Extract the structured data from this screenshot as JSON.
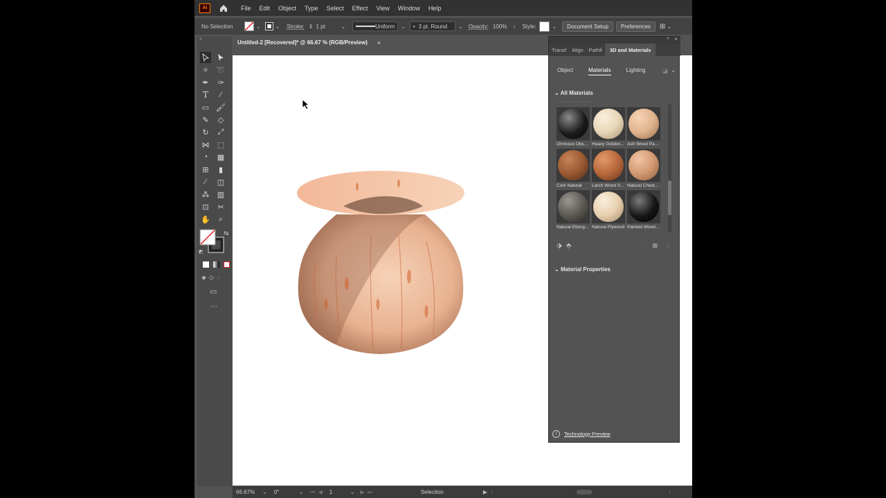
{
  "app": {
    "logo": "Ai",
    "menu": [
      "File",
      "Edit",
      "Object",
      "Type",
      "Select",
      "Effect",
      "View",
      "Window",
      "Help"
    ]
  },
  "control_bar": {
    "selection": "No Selection",
    "stroke_label": "Stroke:",
    "stroke_value": "1 pt",
    "profile": "Uniform",
    "brush": "3 pt. Round",
    "opacity_label": "Opacity:",
    "opacity_value": "100%",
    "style_label": "Style:",
    "document_setup": "Document Setup",
    "preferences": "Preferences"
  },
  "document": {
    "tab_title": "Untitled-2 [Recovered]* @ 66.67 % (RGB/Preview)",
    "close": "×"
  },
  "status": {
    "zoom": "66.67%",
    "rotation": "0°",
    "artboard": "1",
    "tool": "Selection"
  },
  "panel": {
    "tabs": [
      "Transf",
      "Align",
      "Pathfi",
      "3D and Materials"
    ],
    "subtabs": [
      "Object",
      "Materials",
      "Lighting"
    ],
    "all_materials": "All Materials",
    "materials": [
      {
        "label": "Ominous Obs...",
        "color": "#1c1c1c"
      },
      {
        "label": "Heavy Golden...",
        "color": "#e8d6b8"
      },
      {
        "label": "Ash Wood Pa...",
        "color": "#e0b48e"
      },
      {
        "label": "Cork Natural",
        "color": "#9a5a32"
      },
      {
        "label": "Larch Wood V...",
        "color": "#b8683c"
      },
      {
        "label": "Natural Chest...",
        "color": "#d39a72"
      },
      {
        "label": "Natural Ebony...",
        "color": "#5e5a55"
      },
      {
        "label": "Natural Plywood",
        "color": "#e8d0b0"
      },
      {
        "label": "Painted Wood...",
        "color": "#151515"
      }
    ],
    "material_properties": "Material Properties",
    "technology_preview": "Technology Preview"
  }
}
